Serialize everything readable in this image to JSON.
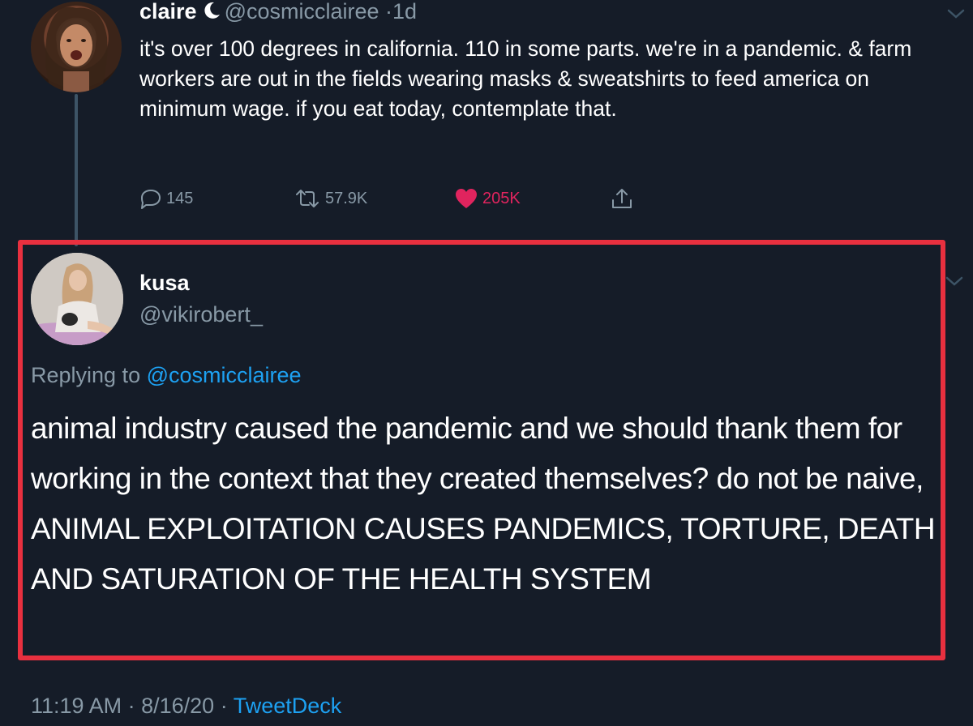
{
  "parent_tweet": {
    "name": "claire",
    "handle": "@cosmicclairee",
    "separator": "·",
    "time": "1d",
    "text": "it's over 100 degrees in california. 110 in some parts. we're in a pandemic. & farm workers are out in the fields wearing masks & sweatshirts to feed america on minimum wage. if you eat today, contemplate that.",
    "replies": "145",
    "retweets": "57.9K",
    "likes": "205K",
    "like_color": "#e0245e"
  },
  "reply_tweet": {
    "name": "kusa",
    "handle": "@vikirobert_",
    "replying_prefix": "Replying to",
    "replying_to": "@cosmicclairee",
    "text": "animal industry caused the pandemic and we should thank them for working in the context that they created themselves? do not be naive, ANIMAL EXPLOITATION CAUSES PANDEMICS, TORTURE, DEATH AND SATURATION OF THE HEALTH SYSTEM",
    "time": "11:19 AM",
    "date": "8/16/20",
    "separator": "·",
    "client": "TweetDeck"
  },
  "colors": {
    "background": "#151c28",
    "highlight_border": "#e8303f",
    "link": "#1da1f2",
    "muted": "#8899a6"
  },
  "icons": [
    "moon-icon",
    "chevron-down-icon",
    "reply-icon",
    "retweet-icon",
    "heart-icon",
    "share-icon"
  ]
}
